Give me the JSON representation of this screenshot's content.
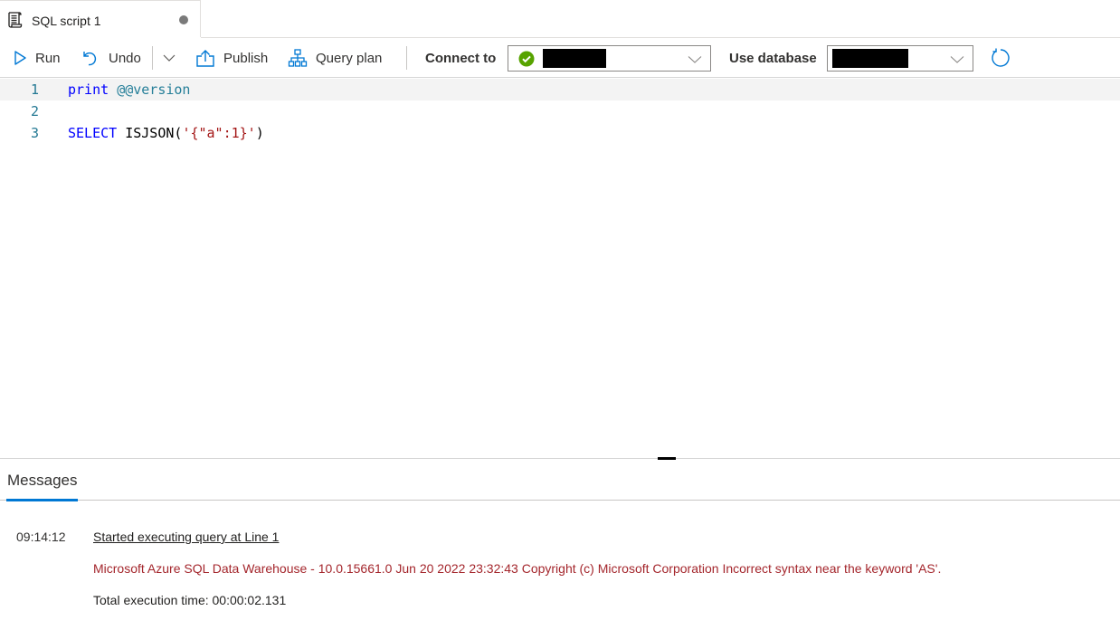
{
  "tab": {
    "title": "SQL script 1",
    "icon": "script-icon",
    "unsaved_indicator": true
  },
  "toolbar": {
    "run_label": "Run",
    "undo_label": "Undo",
    "publish_label": "Publish",
    "query_plan_label": "Query plan",
    "connect_to_label": "Connect to",
    "connect_to_value": "[redacted]",
    "connect_status": "connected",
    "use_database_label": "Use database",
    "use_database_value": "[redacted]"
  },
  "editor": {
    "lines": [
      {
        "number": "1",
        "tokens": [
          {
            "type": "kw",
            "text": "print"
          },
          {
            "type": "plain",
            "text": " "
          },
          {
            "type": "var2",
            "text": "@@version"
          }
        ]
      },
      {
        "number": "2",
        "tokens": []
      },
      {
        "number": "3",
        "tokens": [
          {
            "type": "kw",
            "text": "SELECT"
          },
          {
            "type": "plain",
            "text": " ISJSON("
          },
          {
            "type": "str",
            "text": "'{\"a\":1}'"
          },
          {
            "type": "plain",
            "text": ")"
          }
        ]
      }
    ]
  },
  "results": {
    "tab_label": "Messages",
    "messages": {
      "time": "09:14:12",
      "start_text": "Started executing query at Line 1",
      "error_text": "Microsoft Azure SQL Data Warehouse - 10.0.15661.0 Jun 20 2022 23:32:43 Copyright (c) Microsoft Corporation Incorrect syntax near the keyword 'AS'.",
      "total_text": "Total execution time: 00:00:02.131"
    }
  },
  "colors": {
    "accent": "#0078d4",
    "error": "#a4262c",
    "success": "#57a300"
  }
}
